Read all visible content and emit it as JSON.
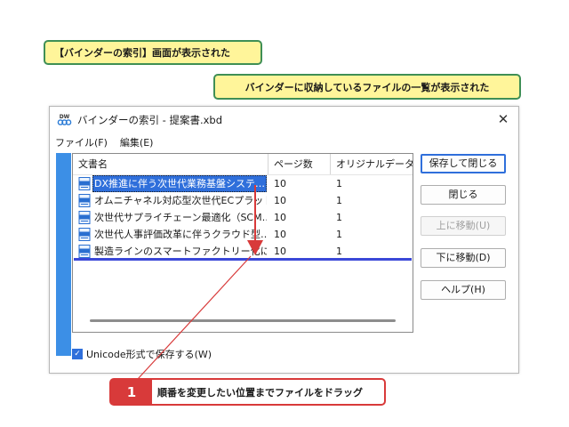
{
  "callouts": {
    "top": "【バインダーの索引】画面が表示された",
    "middle": "バインダーに収納しているファイルの一覧が表示された",
    "step_number": "1",
    "step_text": "順番を変更したい位置までファイルをドラッグ"
  },
  "dialog": {
    "app_icon_text": "DW",
    "title": "バインダーの索引 - 提案書.xbd",
    "close_symbol": "✕"
  },
  "menu": [
    {
      "label": "ファイル(F)"
    },
    {
      "label": "編集(E)"
    }
  ],
  "list": {
    "columns": [
      "文書名",
      "ページ数",
      "オリジナルデータ数"
    ],
    "rows": [
      {
        "name": "DX推進に伴う次世代業務基盤システ…",
        "pages": "10",
        "original": "1",
        "selected": true
      },
      {
        "name": "オムニチャネル対応型次世代ECプラット…",
        "pages": "10",
        "original": "1",
        "selected": false
      },
      {
        "name": "次世代サプライチェーン最適化（SCM…",
        "pages": "10",
        "original": "1",
        "selected": false
      },
      {
        "name": "次世代人事評価改革に伴うクラウド型…",
        "pages": "10",
        "original": "1",
        "selected": false
      },
      {
        "name": "製造ラインのスマートファクトリー化に伴…",
        "pages": "10",
        "original": "1",
        "selected": false
      }
    ]
  },
  "buttons": {
    "save_close": "保存して閉じる",
    "close": "閉じる",
    "move_up": "上に移動(U)",
    "move_down": "下に移動(D)",
    "help": "ヘルプ(H)"
  },
  "checkbox": {
    "label": "Unicode形式で保存する(W)",
    "checked": true
  },
  "colors": {
    "accent_blue": "#2f6fdb",
    "strip_blue": "#3c8fe6",
    "drop_line": "#3b48d8",
    "annotation_red": "#d83a3a",
    "callout_fill": "#fff59a",
    "callout_border": "#3f8f55"
  }
}
